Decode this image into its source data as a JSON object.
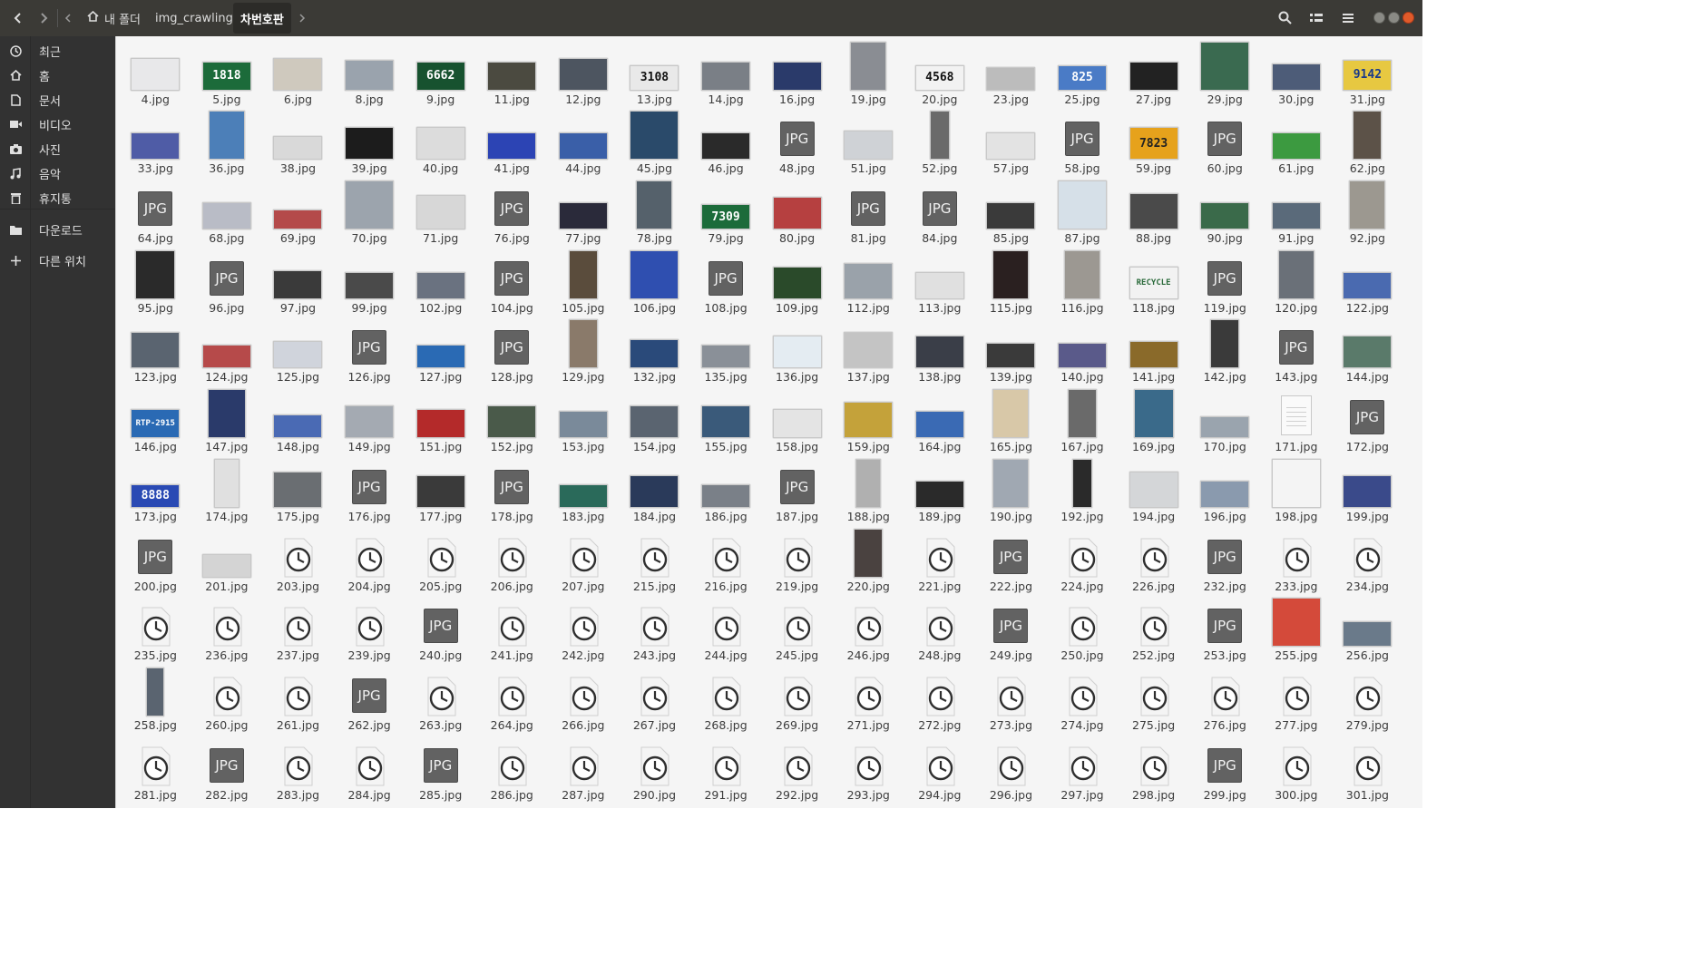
{
  "headerbar": {
    "back_icon": "chevron-left",
    "forward_icon": "chevron-right",
    "path_left_icon": "triangle-left",
    "path_right_icon": "triangle-right",
    "breadcrumbs": [
      "내 폴더",
      "img_crawling",
      "차번호판"
    ],
    "home_icon": "home-icon",
    "search_icon": "search",
    "view_icon": "list-view",
    "menu_icon": "hamburger-menu"
  },
  "sidebar": {
    "items": [
      {
        "label": "최근",
        "icon": "clock-icon"
      },
      {
        "label": "홈",
        "icon": "home-icon"
      },
      {
        "label": "문서",
        "icon": "document-icon"
      },
      {
        "label": "비디오",
        "icon": "video-icon"
      },
      {
        "label": "사진",
        "icon": "camera-icon"
      },
      {
        "label": "음악",
        "icon": "music-icon"
      },
      {
        "label": "휴지통",
        "icon": "trash-icon"
      },
      {
        "label": "다운로드",
        "icon": "folder-icon"
      },
      {
        "label": "다른 위치",
        "icon": "plus-icon"
      }
    ]
  },
  "files": [
    {
      "name": "4.jpg",
      "kind": "img",
      "w": 52,
      "h": 34,
      "color": "#e8e8ea"
    },
    {
      "name": "5.jpg",
      "kind": "plate",
      "w": 52,
      "h": 30,
      "color": "#1c6b3a",
      "text": "1818",
      "fg": "#ffffff"
    },
    {
      "name": "6.jpg",
      "kind": "img",
      "w": 52,
      "h": 34,
      "color": "#cfc9be"
    },
    {
      "name": "8.jpg",
      "kind": "img",
      "w": 52,
      "h": 32,
      "color": "#9aa3ad"
    },
    {
      "name": "9.jpg",
      "kind": "plate",
      "w": 52,
      "h": 30,
      "color": "#17522f",
      "text": "6662",
      "fg": "#ffffff"
    },
    {
      "name": "11.jpg",
      "kind": "img",
      "w": 52,
      "h": 30,
      "color": "#4b4a40"
    },
    {
      "name": "12.jpg",
      "kind": "img",
      "w": 52,
      "h": 34,
      "color": "#4d5560"
    },
    {
      "name": "13.jpg",
      "kind": "plate",
      "w": 52,
      "h": 26,
      "color": "#e9e9e9",
      "text": "3108",
      "fg": "#111"
    },
    {
      "name": "14.jpg",
      "kind": "img",
      "w": 52,
      "h": 30,
      "color": "#7a7f86"
    },
    {
      "name": "16.jpg",
      "kind": "img",
      "w": 52,
      "h": 30,
      "color": "#2a3a6a"
    },
    {
      "name": "19.jpg",
      "kind": "img",
      "w": 38,
      "h": 52,
      "color": "#8a8d93"
    },
    {
      "name": "20.jpg",
      "kind": "plate",
      "w": 52,
      "h": 26,
      "color": "#f2f2f2",
      "text": "4568",
      "fg": "#111"
    },
    {
      "name": "23.jpg",
      "kind": "img",
      "w": 52,
      "h": 24,
      "color": "#bcbcbc"
    },
    {
      "name": "25.jpg",
      "kind": "plate",
      "w": 52,
      "h": 26,
      "color": "#4a7bc6",
      "text": "825",
      "fg": "#ffffff"
    },
    {
      "name": "27.jpg",
      "kind": "img",
      "w": 52,
      "h": 30,
      "color": "#222222"
    },
    {
      "name": "29.jpg",
      "kind": "img",
      "w": 52,
      "h": 52,
      "color": "#3a6a50"
    },
    {
      "name": "30.jpg",
      "kind": "img",
      "w": 52,
      "h": 28,
      "color": "#4d5c78"
    },
    {
      "name": "31.jpg",
      "kind": "plate",
      "w": 52,
      "h": 32,
      "color": "#e7c841",
      "text": "9142",
      "fg": "#1a3a8a"
    },
    {
      "name": "33.jpg",
      "kind": "img",
      "w": 52,
      "h": 28,
      "color": "#4f5ca6"
    },
    {
      "name": "36.jpg",
      "kind": "img",
      "w": 38,
      "h": 52,
      "color": "#4c7fb8"
    },
    {
      "name": "38.jpg",
      "kind": "img",
      "w": 52,
      "h": 24,
      "color": "#d9d9d9"
    },
    {
      "name": "39.jpg",
      "kind": "img",
      "w": 52,
      "h": 34,
      "color": "#1c1c1c"
    },
    {
      "name": "40.jpg",
      "kind": "img",
      "w": 52,
      "h": 34,
      "color": "#dcdcdc"
    },
    {
      "name": "41.jpg",
      "kind": "img",
      "w": 52,
      "h": 28,
      "color": "#2c44b4"
    },
    {
      "name": "44.jpg",
      "kind": "img",
      "w": 52,
      "h": 28,
      "color": "#3a5fa8"
    },
    {
      "name": "45.jpg",
      "kind": "img",
      "w": 52,
      "h": 52,
      "color": "#2a4a6a"
    },
    {
      "name": "46.jpg",
      "kind": "img",
      "w": 52,
      "h": 28,
      "color": "#2a2a2a"
    },
    {
      "name": "48.jpg",
      "kind": "jpg"
    },
    {
      "name": "51.jpg",
      "kind": "img",
      "w": 52,
      "h": 30,
      "color": "#cfd2d6"
    },
    {
      "name": "52.jpg",
      "kind": "img",
      "w": 20,
      "h": 52,
      "color": "#6a6a6a"
    },
    {
      "name": "57.jpg",
      "kind": "img",
      "w": 52,
      "h": 28,
      "color": "#e3e3e3"
    },
    {
      "name": "58.jpg",
      "kind": "jpg"
    },
    {
      "name": "59.jpg",
      "kind": "plate",
      "w": 52,
      "h": 34,
      "color": "#e6a21c",
      "text": "7823",
      "fg": "#222"
    },
    {
      "name": "60.jpg",
      "kind": "jpg"
    },
    {
      "name": "61.jpg",
      "kind": "img",
      "w": 52,
      "h": 28,
      "color": "#3c9a40"
    },
    {
      "name": "62.jpg",
      "kind": "img",
      "w": 30,
      "h": 52,
      "color": "#5c5248"
    },
    {
      "name": "64.jpg",
      "kind": "jpg"
    },
    {
      "name": "68.jpg",
      "kind": "img",
      "w": 52,
      "h": 28,
      "color": "#b9bcc6"
    },
    {
      "name": "69.jpg",
      "kind": "img",
      "w": 52,
      "h": 20,
      "color": "#b44a4a"
    },
    {
      "name": "70.jpg",
      "kind": "img",
      "w": 52,
      "h": 52,
      "color": "#9ca4ad"
    },
    {
      "name": "71.jpg",
      "kind": "img",
      "w": 52,
      "h": 36,
      "color": "#d7d7d7"
    },
    {
      "name": "76.jpg",
      "kind": "jpg"
    },
    {
      "name": "77.jpg",
      "kind": "img",
      "w": 52,
      "h": 28,
      "color": "#2a2a3a"
    },
    {
      "name": "78.jpg",
      "kind": "img",
      "w": 38,
      "h": 52,
      "color": "#55616b"
    },
    {
      "name": "79.jpg",
      "kind": "plate",
      "w": 52,
      "h": 26,
      "color": "#1c6b3a",
      "text": "7309",
      "fg": "#ffffff"
    },
    {
      "name": "80.jpg",
      "kind": "img",
      "w": 52,
      "h": 34,
      "color": "#b64040"
    },
    {
      "name": "81.jpg",
      "kind": "jpg"
    },
    {
      "name": "84.jpg",
      "kind": "jpg"
    },
    {
      "name": "85.jpg",
      "kind": "img",
      "w": 52,
      "h": 28,
      "color": "#3a3a3a"
    },
    {
      "name": "87.jpg",
      "kind": "img",
      "w": 52,
      "h": 52,
      "color": "#d6e0e8"
    },
    {
      "name": "88.jpg",
      "kind": "img",
      "w": 52,
      "h": 38,
      "color": "#4a4a4a"
    },
    {
      "name": "90.jpg",
      "kind": "img",
      "w": 52,
      "h": 28,
      "color": "#3a6a4a"
    },
    {
      "name": "91.jpg",
      "kind": "img",
      "w": 52,
      "h": 28,
      "color": "#5a6a7a"
    },
    {
      "name": "92.jpg",
      "kind": "img",
      "w": 38,
      "h": 52,
      "color": "#9c9890"
    },
    {
      "name": "95.jpg",
      "kind": "img",
      "w": 42,
      "h": 52,
      "color": "#2a2a2a"
    },
    {
      "name": "96.jpg",
      "kind": "jpg"
    },
    {
      "name": "97.jpg",
      "kind": "img",
      "w": 52,
      "h": 30,
      "color": "#3a3a3a"
    },
    {
      "name": "99.jpg",
      "kind": "img",
      "w": 52,
      "h": 28,
      "color": "#4a4a4a"
    },
    {
      "name": "102.jpg",
      "kind": "img",
      "w": 52,
      "h": 28,
      "color": "#6a7280"
    },
    {
      "name": "104.jpg",
      "kind": "jpg"
    },
    {
      "name": "105.jpg",
      "kind": "img",
      "w": 30,
      "h": 52,
      "color": "#5a4c3c"
    },
    {
      "name": "106.jpg",
      "kind": "img",
      "w": 52,
      "h": 52,
      "color": "#2f4fb0"
    },
    {
      "name": "108.jpg",
      "kind": "jpg"
    },
    {
      "name": "109.jpg",
      "kind": "img",
      "w": 52,
      "h": 34,
      "color": "#2a4a2a"
    },
    {
      "name": "112.jpg",
      "kind": "img",
      "w": 52,
      "h": 38,
      "color": "#9aa2aa"
    },
    {
      "name": "113.jpg",
      "kind": "img",
      "w": 52,
      "h": 28,
      "color": "#e0e0e0"
    },
    {
      "name": "115.jpg",
      "kind": "img",
      "w": 38,
      "h": 52,
      "color": "#2a2020"
    },
    {
      "name": "116.jpg",
      "kind": "img",
      "w": 38,
      "h": 52,
      "color": "#9c9892"
    },
    {
      "name": "118.jpg",
      "kind": "plate",
      "w": 52,
      "h": 34,
      "color": "#f2f2f2",
      "text": "RECYCLE",
      "fg": "#2a6a3a"
    },
    {
      "name": "119.jpg",
      "kind": "jpg"
    },
    {
      "name": "120.jpg",
      "kind": "img",
      "w": 38,
      "h": 52,
      "color": "#6a7078"
    },
    {
      "name": "122.jpg",
      "kind": "img",
      "w": 52,
      "h": 28,
      "color": "#4a6ab0"
    },
    {
      "name": "123.jpg",
      "kind": "img",
      "w": 52,
      "h": 38,
      "color": "#5a6470"
    },
    {
      "name": "124.jpg",
      "kind": "img",
      "w": 52,
      "h": 24,
      "color": "#b64a4a"
    },
    {
      "name": "125.jpg",
      "kind": "img",
      "w": 52,
      "h": 28,
      "color": "#d0d4dc"
    },
    {
      "name": "126.jpg",
      "kind": "jpg"
    },
    {
      "name": "127.jpg",
      "kind": "img",
      "w": 52,
      "h": 24,
      "color": "#2a6ab4"
    },
    {
      "name": "128.jpg",
      "kind": "jpg"
    },
    {
      "name": "129.jpg",
      "kind": "img",
      "w": 30,
      "h": 52,
      "color": "#8a7a6a"
    },
    {
      "name": "132.jpg",
      "kind": "img",
      "w": 52,
      "h": 30,
      "color": "#2a4a7a"
    },
    {
      "name": "135.jpg",
      "kind": "img",
      "w": 52,
      "h": 24,
      "color": "#8a9098"
    },
    {
      "name": "136.jpg",
      "kind": "img",
      "w": 52,
      "h": 34,
      "color": "#e4ecf2"
    },
    {
      "name": "137.jpg",
      "kind": "img",
      "w": 52,
      "h": 38,
      "color": "#c4c4c4"
    },
    {
      "name": "138.jpg",
      "kind": "img",
      "w": 52,
      "h": 34,
      "color": "#3a3e48"
    },
    {
      "name": "139.jpg",
      "kind": "img",
      "w": 52,
      "h": 26,
      "color": "#3a3a3a"
    },
    {
      "name": "140.jpg",
      "kind": "img",
      "w": 52,
      "h": 26,
      "color": "#5a5a8a"
    },
    {
      "name": "141.jpg",
      "kind": "img",
      "w": 52,
      "h": 28,
      "color": "#8a6a2a"
    },
    {
      "name": "142.jpg",
      "kind": "img",
      "w": 30,
      "h": 52,
      "color": "#3a3a3a"
    },
    {
      "name": "143.jpg",
      "kind": "jpg"
    },
    {
      "name": "144.jpg",
      "kind": "img",
      "w": 52,
      "h": 34,
      "color": "#5a7a6a"
    },
    {
      "name": "146.jpg",
      "kind": "plate",
      "w": 52,
      "h": 30,
      "color": "#2a6ab4",
      "text": "RTP-2915",
      "fg": "#ffffff"
    },
    {
      "name": "147.jpg",
      "kind": "img",
      "w": 40,
      "h": 52,
      "color": "#2a3a6a"
    },
    {
      "name": "148.jpg",
      "kind": "img",
      "w": 52,
      "h": 24,
      "color": "#4a6ab4"
    },
    {
      "name": "149.jpg",
      "kind": "img",
      "w": 52,
      "h": 34,
      "color": "#a4aab2"
    },
    {
      "name": "151.jpg",
      "kind": "img",
      "w": 52,
      "h": 30,
      "color": "#b42a2a"
    },
    {
      "name": "152.jpg",
      "kind": "img",
      "w": 52,
      "h": 34,
      "color": "#4a5a4a"
    },
    {
      "name": "153.jpg",
      "kind": "img",
      "w": 52,
      "h": 28,
      "color": "#7a8a9a"
    },
    {
      "name": "154.jpg",
      "kind": "img",
      "w": 52,
      "h": 34,
      "color": "#5a6470"
    },
    {
      "name": "155.jpg",
      "kind": "img",
      "w": 52,
      "h": 34,
      "color": "#3a5a7a"
    },
    {
      "name": "158.jpg",
      "kind": "img",
      "w": 52,
      "h": 30,
      "color": "#e4e4e4"
    },
    {
      "name": "159.jpg",
      "kind": "img",
      "w": 52,
      "h": 38,
      "color": "#c4a23a"
    },
    {
      "name": "164.jpg",
      "kind": "img",
      "w": 52,
      "h": 28,
      "color": "#3a6ab4"
    },
    {
      "name": "165.jpg",
      "kind": "img",
      "w": 38,
      "h": 52,
      "color": "#d8c8a8"
    },
    {
      "name": "167.jpg",
      "kind": "img",
      "w": 30,
      "h": 52,
      "color": "#6a6a6a"
    },
    {
      "name": "169.jpg",
      "kind": "img",
      "w": 42,
      "h": 52,
      "color": "#3a6a8a"
    },
    {
      "name": "170.jpg",
      "kind": "img",
      "w": 52,
      "h": 22,
      "color": "#9aa4ae"
    },
    {
      "name": "171.jpg",
      "kind": "doc"
    },
    {
      "name": "172.jpg",
      "kind": "jpg"
    },
    {
      "name": "173.jpg",
      "kind": "plate",
      "w": 52,
      "h": 24,
      "color": "#2a4ab4",
      "text": "8888",
      "fg": "#ffffff"
    },
    {
      "name": "174.jpg",
      "kind": "img",
      "w": 26,
      "h": 52,
      "color": "#e0e0e0"
    },
    {
      "name": "175.jpg",
      "kind": "img",
      "w": 52,
      "h": 38,
      "color": "#6a6e72"
    },
    {
      "name": "176.jpg",
      "kind": "jpg"
    },
    {
      "name": "177.jpg",
      "kind": "img",
      "w": 52,
      "h": 34,
      "color": "#3a3a3a"
    },
    {
      "name": "178.jpg",
      "kind": "jpg"
    },
    {
      "name": "183.jpg",
      "kind": "img",
      "w": 52,
      "h": 24,
      "color": "#2a6a5a"
    },
    {
      "name": "184.jpg",
      "kind": "img",
      "w": 52,
      "h": 34,
      "color": "#2a3a5a"
    },
    {
      "name": "186.jpg",
      "kind": "img",
      "w": 52,
      "h": 24,
      "color": "#7a8088"
    },
    {
      "name": "187.jpg",
      "kind": "jpg"
    },
    {
      "name": "188.jpg",
      "kind": "img",
      "w": 26,
      "h": 52,
      "color": "#b0b0b0"
    },
    {
      "name": "189.jpg",
      "kind": "img",
      "w": 52,
      "h": 28,
      "color": "#2a2a2a"
    },
    {
      "name": "190.jpg",
      "kind": "img",
      "w": 38,
      "h": 52,
      "color": "#a0a8b2"
    },
    {
      "name": "192.jpg",
      "kind": "img",
      "w": 20,
      "h": 52,
      "color": "#2a2a2a"
    },
    {
      "name": "194.jpg",
      "kind": "img",
      "w": 52,
      "h": 38,
      "color": "#d4d6d8"
    },
    {
      "name": "196.jpg",
      "kind": "img",
      "w": 52,
      "h": 28,
      "color": "#8a9aae"
    },
    {
      "name": "198.jpg",
      "kind": "img",
      "w": 52,
      "h": 52,
      "color": "#f4f4f4"
    },
    {
      "name": "199.jpg",
      "kind": "img",
      "w": 52,
      "h": 34,
      "color": "#3a4a8a"
    },
    {
      "name": "200.jpg",
      "kind": "jpg"
    },
    {
      "name": "201.jpg",
      "kind": "img",
      "w": 52,
      "h": 24,
      "color": "#d4d4d4"
    },
    {
      "name": "203.jpg",
      "kind": "clock"
    },
    {
      "name": "204.jpg",
      "kind": "clock"
    },
    {
      "name": "205.jpg",
      "kind": "clock"
    },
    {
      "name": "206.jpg",
      "kind": "clock"
    },
    {
      "name": "207.jpg",
      "kind": "clock"
    },
    {
      "name": "215.jpg",
      "kind": "clock"
    },
    {
      "name": "216.jpg",
      "kind": "clock"
    },
    {
      "name": "219.jpg",
      "kind": "clock"
    },
    {
      "name": "220.jpg",
      "kind": "img",
      "w": 30,
      "h": 52,
      "color": "#4a4240"
    },
    {
      "name": "221.jpg",
      "kind": "clock"
    },
    {
      "name": "222.jpg",
      "kind": "jpg"
    },
    {
      "name": "224.jpg",
      "kind": "clock"
    },
    {
      "name": "226.jpg",
      "kind": "clock"
    },
    {
      "name": "232.jpg",
      "kind": "jpg"
    },
    {
      "name": "233.jpg",
      "kind": "clock"
    },
    {
      "name": "234.jpg",
      "kind": "clock"
    },
    {
      "name": "235.jpg",
      "kind": "clock"
    },
    {
      "name": "236.jpg",
      "kind": "clock"
    },
    {
      "name": "237.jpg",
      "kind": "clock"
    },
    {
      "name": "239.jpg",
      "kind": "clock"
    },
    {
      "name": "240.jpg",
      "kind": "jpg"
    },
    {
      "name": "241.jpg",
      "kind": "clock"
    },
    {
      "name": "242.jpg",
      "kind": "clock"
    },
    {
      "name": "243.jpg",
      "kind": "clock"
    },
    {
      "name": "244.jpg",
      "kind": "clock"
    },
    {
      "name": "245.jpg",
      "kind": "clock"
    },
    {
      "name": "246.jpg",
      "kind": "clock"
    },
    {
      "name": "248.jpg",
      "kind": "clock"
    },
    {
      "name": "249.jpg",
      "kind": "jpg"
    },
    {
      "name": "250.jpg",
      "kind": "clock"
    },
    {
      "name": "252.jpg",
      "kind": "clock"
    },
    {
      "name": "253.jpg",
      "kind": "jpg"
    },
    {
      "name": "255.jpg",
      "kind": "img",
      "w": 52,
      "h": 52,
      "color": "#d44a3a"
    },
    {
      "name": "256.jpg",
      "kind": "img",
      "w": 52,
      "h": 26,
      "color": "#6a7a8a"
    },
    {
      "name": "258.jpg",
      "kind": "img",
      "w": 18,
      "h": 52,
      "color": "#5a6470"
    },
    {
      "name": "260.jpg",
      "kind": "clock"
    },
    {
      "name": "261.jpg",
      "kind": "clock"
    },
    {
      "name": "262.jpg",
      "kind": "jpg"
    },
    {
      "name": "263.jpg",
      "kind": "clock"
    },
    {
      "name": "264.jpg",
      "kind": "clock"
    },
    {
      "name": "266.jpg",
      "kind": "clock"
    },
    {
      "name": "267.jpg",
      "kind": "clock"
    },
    {
      "name": "268.jpg",
      "kind": "clock"
    },
    {
      "name": "269.jpg",
      "kind": "clock"
    },
    {
      "name": "271.jpg",
      "kind": "clock"
    },
    {
      "name": "272.jpg",
      "kind": "clock"
    },
    {
      "name": "273.jpg",
      "kind": "clock"
    },
    {
      "name": "274.jpg",
      "kind": "clock"
    },
    {
      "name": "275.jpg",
      "kind": "clock"
    },
    {
      "name": "276.jpg",
      "kind": "clock"
    },
    {
      "name": "277.jpg",
      "kind": "clock"
    },
    {
      "name": "279.jpg",
      "kind": "clock"
    },
    {
      "name": "281.jpg",
      "kind": "clock"
    },
    {
      "name": "282.jpg",
      "kind": "jpg"
    },
    {
      "name": "283.jpg",
      "kind": "clock"
    },
    {
      "name": "284.jpg",
      "kind": "clock"
    },
    {
      "name": "285.jpg",
      "kind": "jpg"
    },
    {
      "name": "286.jpg",
      "kind": "clock"
    },
    {
      "name": "287.jpg",
      "kind": "clock"
    },
    {
      "name": "290.jpg",
      "kind": "clock"
    },
    {
      "name": "291.jpg",
      "kind": "clock"
    },
    {
      "name": "292.jpg",
      "kind": "clock"
    },
    {
      "name": "293.jpg",
      "kind": "clock"
    },
    {
      "name": "294.jpg",
      "kind": "clock"
    },
    {
      "name": "296.jpg",
      "kind": "clock"
    },
    {
      "name": "297.jpg",
      "kind": "clock"
    },
    {
      "name": "298.jpg",
      "kind": "clock"
    },
    {
      "name": "299.jpg",
      "kind": "jpg"
    },
    {
      "name": "300.jpg",
      "kind": "clock"
    },
    {
      "name": "301.jpg",
      "kind": "clock"
    }
  ]
}
